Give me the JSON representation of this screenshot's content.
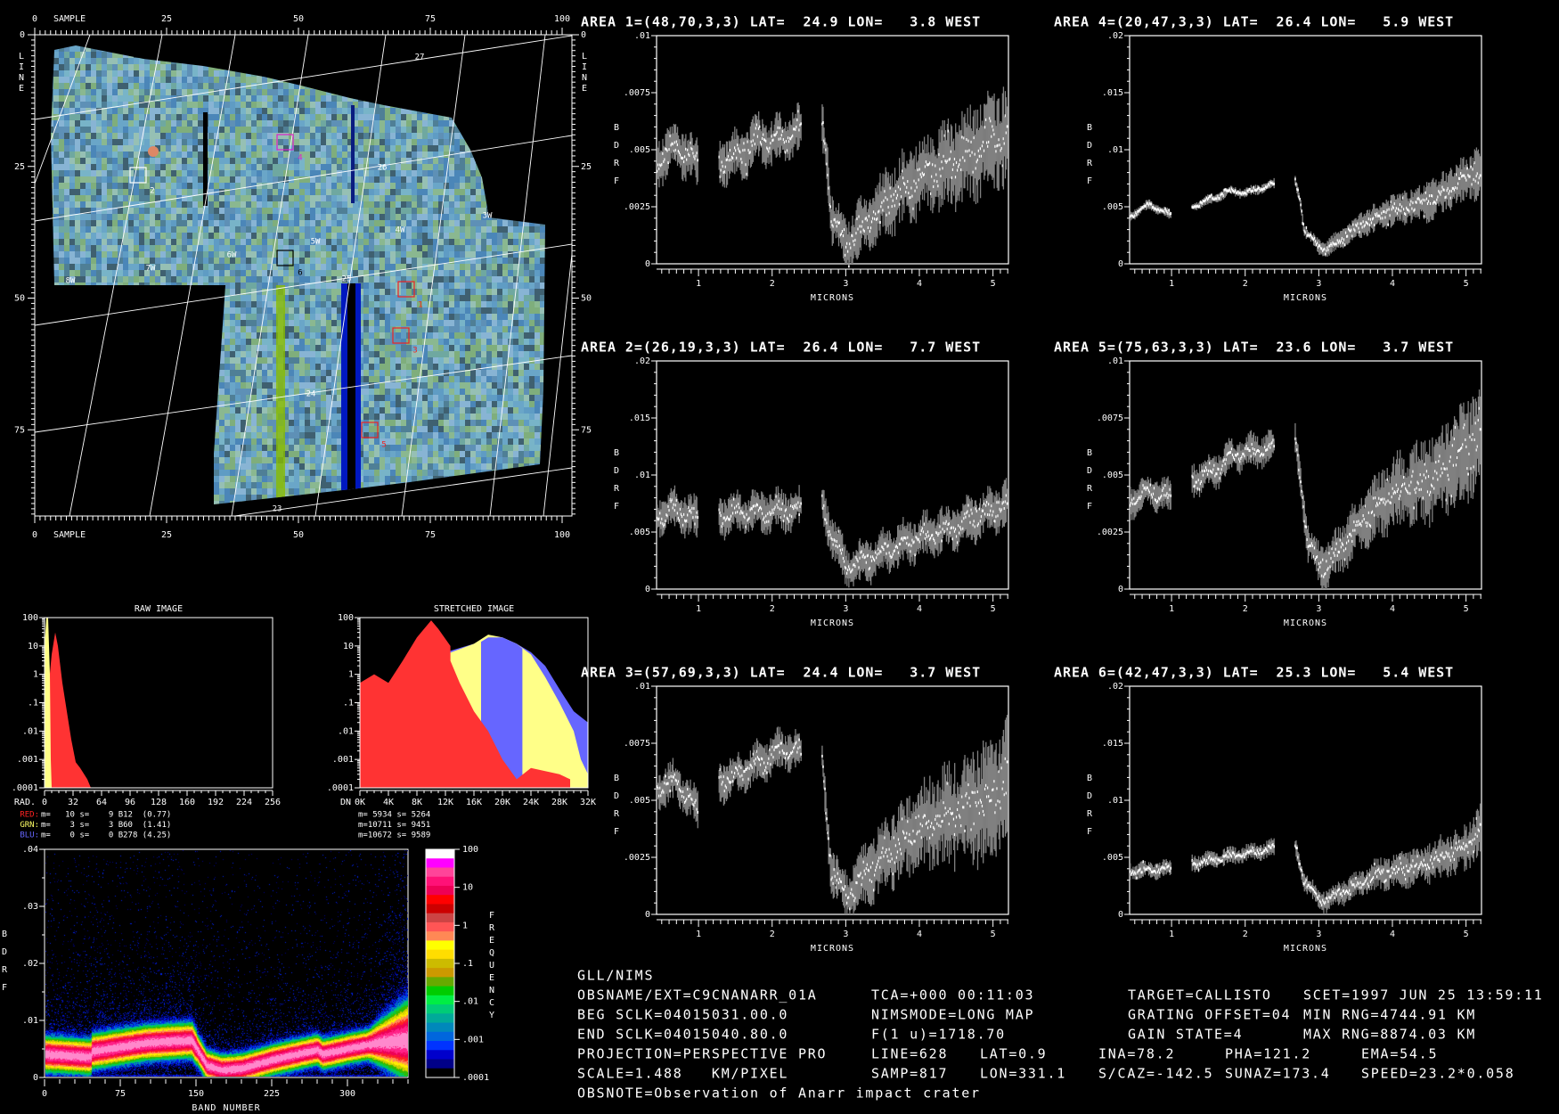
{
  "map": {
    "axis_title": "SAMPLE",
    "line_label": [
      "L",
      "I",
      "N",
      "E"
    ],
    "x_ticks": [
      "0",
      "25",
      "50",
      "75",
      "100"
    ],
    "y_ticks": [
      "0",
      "25",
      "50",
      "75"
    ],
    "lat_labels": [
      "27",
      "26",
      "25",
      "24",
      "23"
    ],
    "lon_labels": [
      "3W",
      "4W",
      "5W",
      "6W",
      "7W",
      "8W"
    ],
    "areas": [
      {
        "label": "1",
        "color": "#ee2222"
      },
      {
        "label": "2",
        "color": "#ffffff"
      },
      {
        "label": "3",
        "color": "#ee2222"
      },
      {
        "label": "4",
        "color": "#dd22cc"
      },
      {
        "label": "5",
        "color": "#ee2222"
      },
      {
        "label": "6",
        "color": "#000000"
      }
    ]
  },
  "spectra": [
    {
      "title": "AREA 1=(48,70,3,3) LAT=  24.9 LON=   3.8 WEST",
      "ylabel": [
        "B",
        "D",
        "R",
        "F"
      ],
      "xlabel": "MICRONS",
      "y_ticks": [
        "0",
        ".0025",
        ".005",
        ".0075",
        ".01"
      ],
      "ymax": 0.01,
      "x_ticks": [
        "1",
        "2",
        "3",
        "4",
        "5"
      ],
      "noise": [
        0.0007,
        0.0016
      ],
      "points": [
        [
          0.44,
          0.0045
        ],
        [
          0.7,
          0.0052
        ],
        [
          1.0,
          0.0043
        ],
        [
          1.28,
          0.0045
        ],
        [
          1.6,
          0.0048
        ],
        [
          1.8,
          0.0055
        ],
        [
          2.0,
          0.0053
        ],
        [
          2.2,
          0.0056
        ],
        [
          2.4,
          0.0058
        ],
        [
          2.68,
          0.006
        ],
        [
          2.75,
          0.0045
        ],
        [
          2.8,
          0.0022
        ],
        [
          3.0,
          0.0008
        ],
        [
          3.2,
          0.0015
        ],
        [
          3.5,
          0.0025
        ],
        [
          3.8,
          0.0033
        ],
        [
          4.0,
          0.0038
        ],
        [
          4.5,
          0.0045
        ],
        [
          4.8,
          0.005
        ],
        [
          5.0,
          0.0055
        ],
        [
          5.2,
          0.0055
        ]
      ]
    },
    {
      "title": "AREA 4=(20,47,3,3) LAT=  26.4 LON=   5.9 WEST",
      "ylabel": [
        "B",
        "D",
        "R",
        "F"
      ],
      "xlabel": "MICRONS",
      "y_ticks": [
        "0",
        ".005",
        ".01",
        ".015",
        ".02"
      ],
      "ymax": 0.02,
      "x_ticks": [
        "1",
        "2",
        "3",
        "4",
        "5"
      ],
      "noise": [
        0.0003,
        0.0016
      ],
      "points": [
        [
          0.44,
          0.0042
        ],
        [
          0.7,
          0.0052
        ],
        [
          1.0,
          0.0042
        ],
        [
          1.28,
          0.005
        ],
        [
          1.6,
          0.0058
        ],
        [
          1.8,
          0.0064
        ],
        [
          2.0,
          0.0062
        ],
        [
          2.4,
          0.007
        ],
        [
          2.68,
          0.0072
        ],
        [
          2.75,
          0.0055
        ],
        [
          2.8,
          0.003
        ],
        [
          3.0,
          0.0015
        ],
        [
          3.1,
          0.0013
        ],
        [
          3.3,
          0.0022
        ],
        [
          3.6,
          0.0035
        ],
        [
          4.0,
          0.0047
        ],
        [
          4.5,
          0.0055
        ],
        [
          5.0,
          0.0075
        ],
        [
          5.2,
          0.008
        ]
      ]
    },
    {
      "title": "AREA 2=(26,19,3,3) LAT=  26.4 LON=   7.7 WEST",
      "ylabel": [
        "B",
        "D",
        "R",
        "F"
      ],
      "xlabel": "MICRONS",
      "y_ticks": [
        "0",
        ".005",
        ".01",
        ".015",
        ".02"
      ],
      "ymax": 0.02,
      "x_ticks": [
        "1",
        "2",
        "3",
        "4",
        "5"
      ],
      "noise": [
        0.0012,
        0.0014
      ],
      "points": [
        [
          0.44,
          0.0065
        ],
        [
          0.7,
          0.007
        ],
        [
          1.0,
          0.006
        ],
        [
          1.28,
          0.0065
        ],
        [
          1.8,
          0.0068
        ],
        [
          2.4,
          0.007
        ],
        [
          2.68,
          0.0075
        ],
        [
          2.8,
          0.005
        ],
        [
          3.0,
          0.002
        ],
        [
          3.2,
          0.0022
        ],
        [
          3.6,
          0.0035
        ],
        [
          4.0,
          0.0045
        ],
        [
          4.5,
          0.0055
        ],
        [
          5.2,
          0.0075
        ]
      ]
    },
    {
      "title": "AREA 5=(75,63,3,3) LAT=  23.6 LON=   3.7 WEST",
      "ylabel": [
        "B",
        "D",
        "R",
        "F"
      ],
      "xlabel": "MICRONS",
      "y_ticks": [
        "0",
        ".0025",
        ".005",
        ".0075",
        ".01"
      ],
      "ymax": 0.01,
      "x_ticks": [
        "1",
        "2",
        "3",
        "4",
        "5"
      ],
      "noise": [
        0.0005,
        0.0016
      ],
      "points": [
        [
          0.44,
          0.0038
        ],
        [
          0.7,
          0.0043
        ],
        [
          1.0,
          0.004
        ],
        [
          1.28,
          0.0048
        ],
        [
          1.6,
          0.0052
        ],
        [
          1.8,
          0.0058
        ],
        [
          2.0,
          0.006
        ],
        [
          2.4,
          0.0062
        ],
        [
          2.68,
          0.0065
        ],
        [
          2.75,
          0.005
        ],
        [
          2.85,
          0.002
        ],
        [
          3.0,
          0.0012
        ],
        [
          3.1,
          0.001
        ],
        [
          3.3,
          0.0018
        ],
        [
          3.6,
          0.003
        ],
        [
          4.0,
          0.0042
        ],
        [
          4.5,
          0.0048
        ],
        [
          5.0,
          0.006
        ],
        [
          5.2,
          0.0068
        ]
      ]
    },
    {
      "title": "AREA 3=(57,69,3,3) LAT=  24.4 LON=   3.7 WEST",
      "ylabel": [
        "B",
        "D",
        "R",
        "F"
      ],
      "xlabel": "MICRONS",
      "y_ticks": [
        "0",
        ".0025",
        ".005",
        ".0075",
        ".01"
      ],
      "ymax": 0.01,
      "x_ticks": [
        "1",
        "2",
        "3",
        "4",
        "5"
      ],
      "noise": [
        0.0006,
        0.002
      ],
      "points": [
        [
          0.44,
          0.0055
        ],
        [
          0.7,
          0.0058
        ],
        [
          1.0,
          0.0045
        ],
        [
          1.28,
          0.0058
        ],
        [
          1.6,
          0.0062
        ],
        [
          2.0,
          0.007
        ],
        [
          2.2,
          0.0073
        ],
        [
          2.4,
          0.007
        ],
        [
          2.68,
          0.0068
        ],
        [
          2.8,
          0.002
        ],
        [
          3.0,
          0.0008
        ],
        [
          3.2,
          0.0015
        ],
        [
          3.6,
          0.0028
        ],
        [
          4.0,
          0.0038
        ],
        [
          4.5,
          0.0045
        ],
        [
          5.0,
          0.005
        ],
        [
          5.2,
          0.006
        ]
      ]
    },
    {
      "title": "AREA 6=(42,47,3,3) LAT=  25.3 LON=   5.4 WEST",
      "ylabel": [
        "B",
        "D",
        "R",
        "F"
      ],
      "xlabel": "MICRONS",
      "y_ticks": [
        "0",
        ".005",
        ".01",
        ".015",
        ".02"
      ],
      "ymax": 0.02,
      "x_ticks": [
        "1",
        "2",
        "3",
        "4",
        "5"
      ],
      "noise": [
        0.0005,
        0.0015
      ],
      "points": [
        [
          0.44,
          0.0038
        ],
        [
          1.0,
          0.004
        ],
        [
          1.28,
          0.0045
        ],
        [
          2.4,
          0.0058
        ],
        [
          2.68,
          0.006
        ],
        [
          2.8,
          0.003
        ],
        [
          3.0,
          0.0013
        ],
        [
          3.1,
          0.0012
        ],
        [
          3.4,
          0.0022
        ],
        [
          3.8,
          0.0035
        ],
        [
          4.2,
          0.004
        ],
        [
          4.6,
          0.0048
        ],
        [
          5.0,
          0.0058
        ],
        [
          5.2,
          0.0075
        ]
      ]
    }
  ],
  "histograms": {
    "y_ticks": [
      "100",
      "10",
      "1",
      ".1",
      ".01",
      ".001",
      ".0001"
    ],
    "raw": {
      "title": "RAW IMAGE",
      "axis_label": "RAD.",
      "x_ticks": [
        "0",
        "32",
        "64",
        "96",
        "128",
        "160",
        "192",
        "224",
        "256"
      ],
      "xmax": 256,
      "series": [
        {
          "name": "red",
          "color": "#ff3333",
          "points": [
            [
              0,
              0.0001
            ],
            [
              0,
              0.8
            ],
            [
              5,
              0.5
            ],
            [
              8,
              5
            ],
            [
              12,
              30
            ],
            [
              15,
              10
            ],
            [
              20,
              0.5
            ],
            [
              25,
              0.05
            ],
            [
              30,
              0.005
            ],
            [
              35,
              0.0008
            ],
            [
              40,
              0.0005
            ],
            [
              48,
              0.0002
            ],
            [
              52,
              0.0001
            ]
          ]
        },
        {
          "name": "yellow",
          "color": "#ffff88",
          "points": [
            [
              0,
              0.0001
            ],
            [
              0,
              10
            ],
            [
              2,
              100
            ],
            [
              4,
              100
            ],
            [
              6,
              1
            ],
            [
              7,
              0.001
            ],
            [
              8,
              0.0001
            ]
          ]
        }
      ]
    },
    "stretched": {
      "title": "STRETCHED IMAGE",
      "axis_label": "DN",
      "x_ticks": [
        "0K",
        "4K",
        "8K",
        "12K",
        "16K",
        "20K",
        "24K",
        "28K",
        "32K"
      ],
      "xmax": 32000,
      "series": [
        {
          "name": "blue",
          "color": "#6666ff",
          "points": [
            [
              0,
              0.0001
            ],
            [
              0,
              0.3
            ],
            [
              4000,
              0.4
            ],
            [
              8000,
              2
            ],
            [
              12000,
              6
            ],
            [
              16000,
              12
            ],
            [
              18000,
              20
            ],
            [
              20000,
              20
            ],
            [
              22000,
              12
            ],
            [
              24000,
              6
            ],
            [
              26000,
              2
            ],
            [
              28000,
              0.3
            ],
            [
              30000,
              0.05
            ],
            [
              32000,
              0.02
            ],
            [
              32000,
              0.0001
            ]
          ]
        },
        {
          "name": "yellow",
          "color": "#ffff88",
          "points": [
            [
              0,
              0.0001
            ],
            [
              0,
              0.4
            ],
            [
              4000,
              0.5
            ],
            [
              8000,
              1.5
            ],
            [
              12000,
              5
            ],
            [
              16000,
              12
            ],
            [
              18000,
              25
            ],
            [
              20000,
              20
            ],
            [
              22000,
              12
            ],
            [
              24000,
              5
            ],
            [
              26000,
              0.8
            ],
            [
              28000,
              0.1
            ],
            [
              30000,
              0.01
            ],
            [
              31000,
              0.001
            ],
            [
              32000,
              0.0003
            ],
            [
              32000,
              0.0001
            ]
          ]
        },
        {
          "name": "blue-band",
          "color": "#6666ff",
          "points": [
            [
              17000,
              0.0001
            ],
            [
              17000,
              14
            ],
            [
              18000,
              20
            ],
            [
              20000,
              20
            ],
            [
              22000,
              12
            ],
            [
              22800,
              8
            ],
            [
              22800,
              0.0001
            ]
          ]
        },
        {
          "name": "red",
          "color": "#ff3333",
          "points": [
            [
              0,
              0.0001
            ],
            [
              0,
              0.5
            ],
            [
              2000,
              1
            ],
            [
              4000,
              0.5
            ],
            [
              6000,
              3
            ],
            [
              8000,
              20
            ],
            [
              10000,
              80
            ],
            [
              11000,
              40
            ],
            [
              12700,
              10
            ],
            [
              12700,
              3
            ],
            [
              14000,
              0.5
            ],
            [
              16000,
              0.05
            ],
            [
              18000,
              0.01
            ],
            [
              20000,
              0.001
            ],
            [
              22000,
              0.0002
            ],
            [
              24000,
              0.0005
            ],
            [
              28000,
              0.0003
            ],
            [
              29500,
              0.0002
            ],
            [
              29500,
              0.0001
            ]
          ]
        }
      ]
    },
    "raw_stats": [
      {
        "channel": "RED:",
        "text": "m=   10 s=    9 B12  (0.77)",
        "color": "#ff2222"
      },
      {
        "channel": "GRN:",
        "text": "m=    3 s=    3 B60  (1.41)",
        "color": "#ffff66"
      },
      {
        "channel": "BLU:",
        "text": "m=    0 s=    0 B278 (4.25)",
        "color": "#6666ff"
      }
    ],
    "stretched_stats": [
      "m= 5934 s= 5264",
      "m=10711 s= 9451",
      "m=10672 s= 9589"
    ]
  },
  "density": {
    "ylabel": [
      "B",
      "D",
      "R",
      "F"
    ],
    "xlabel": "BAND NUMBER",
    "y_ticks": [
      "0",
      ".01",
      ".02",
      ".03",
      ".04"
    ],
    "x_ticks": [
      "0",
      "75",
      "150",
      "225",
      "300"
    ],
    "xmax": 360,
    "ymax": 0.04,
    "mean_curve": [
      [
        0,
        0.004
      ],
      [
        45,
        0.0035
      ],
      [
        46,
        0.0045
      ],
      [
        100,
        0.006
      ],
      [
        145,
        0.0065
      ],
      [
        150,
        0.005
      ],
      [
        160,
        0.002
      ],
      [
        175,
        0.0012
      ],
      [
        195,
        0.0015
      ],
      [
        225,
        0.003
      ],
      [
        270,
        0.0048
      ],
      [
        275,
        0.004
      ],
      [
        300,
        0.005
      ],
      [
        330,
        0.006
      ],
      [
        358,
        0.0065
      ]
    ],
    "colorbar_ticks": [
      "100",
      "10",
      "1",
      ".1",
      ".01",
      ".001",
      ".0001"
    ],
    "colorbar_label": [
      "F",
      "R",
      "E",
      "Q",
      "U",
      "E",
      "N",
      "C",
      "Y"
    ],
    "colorbar_colors": [
      "#ffffff",
      "#ff00ff",
      "#ff4499",
      "#ff1177",
      "#ee0055",
      "#ff0000",
      "#cc0000",
      "#cc4444",
      "#ff5555",
      "#ff8855",
      "#ffff00",
      "#ffdd00",
      "#ccbb00",
      "#cc9900",
      "#66aa00",
      "#00cc00",
      "#00ee44",
      "#00cc77",
      "#00aa99",
      "#0088bb",
      "#0066dd",
      "#0033ff",
      "#0000cc",
      "#000088",
      "#000000"
    ]
  },
  "info": {
    "rows": [
      [
        "GLL/NIMS"
      ],
      [
        "OBSNAME/EXT=C9CNANARR_01A",
        "TCA=+000 00:11:03",
        "TARGET=CALLISTO",
        "SCET=1997 JUN 25 13:59:11"
      ],
      [
        "BEG SCLK=04015031.00.0",
        "NIMSMODE=LONG MAP",
        "GRATING OFFSET=04",
        "MIN RNG=4744.91 KM"
      ],
      [
        "END SCLK=04015040.80.0",
        "F(1 u)=1718.70",
        "GAIN STATE=4",
        "MAX RNG=8874.03 KM"
      ],
      [
        "PROJECTION=PERSPECTIVE PRO",
        "LINE=628",
        "LAT=0.9",
        "INA=78.2",
        "PHA=121.2",
        "EMA=54.5"
      ],
      [
        "SCALE=1.488   KM/PIXEL",
        "SAMP=817",
        "LON=331.1",
        "S/CAZ=-142.5",
        "SUNAZ=173.4",
        "SPEED=23.2*0.058"
      ],
      [
        "OBSNOTE=Observation of Anarr impact crater"
      ]
    ]
  }
}
